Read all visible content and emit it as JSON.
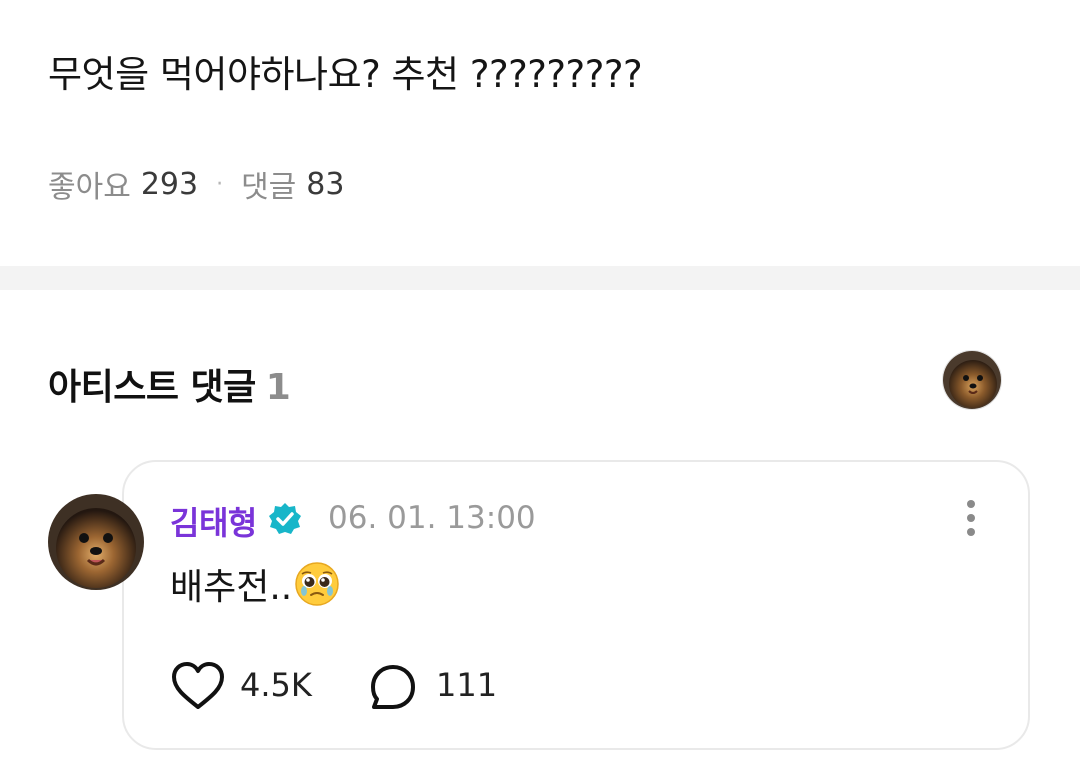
{
  "post": {
    "text": "무엇을 먹어야하나요? 추천 ?????????",
    "likes_label": "좋아요",
    "likes_count": "293",
    "separator": "·",
    "comments_label": "댓글",
    "comments_count": "83"
  },
  "artist_comments": {
    "title": "아티스트 댓글",
    "count": "1"
  },
  "comment": {
    "author": "김태형",
    "timestamp": "06. 01. 13:00",
    "body_text": "배추전..",
    "body_emoji": "pleading-face-emoji",
    "likes": "4.5K",
    "replies": "111"
  },
  "colors": {
    "author": "#7a34d9",
    "verified_badge": "#18b6c9",
    "muted": "#8c8c8c",
    "divider": "#f3f3f3"
  },
  "icons": [
    "verified-badge-icon",
    "more-icon",
    "heart-icon",
    "reply-bubble-icon"
  ]
}
